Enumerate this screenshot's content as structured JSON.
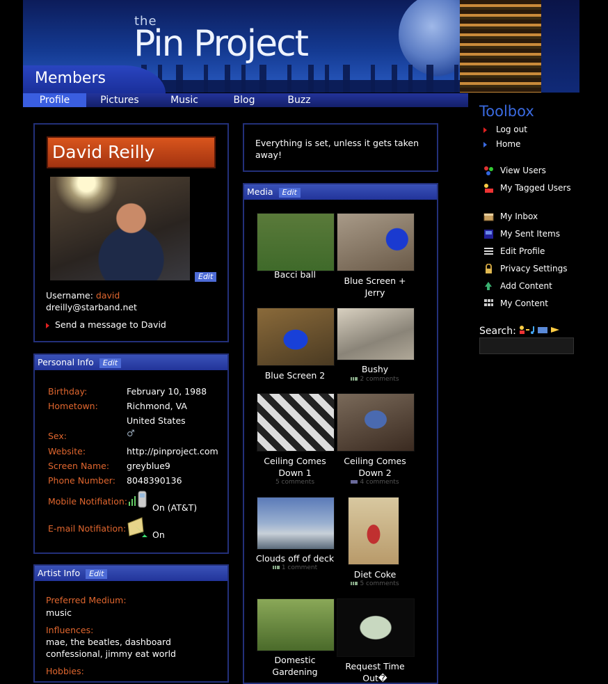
{
  "header": {
    "logo_the": "the",
    "logo_main": "Pin Project",
    "section_title": "Members"
  },
  "nav": [
    {
      "label": "Profile",
      "active": true
    },
    {
      "label": "Pictures",
      "active": false
    },
    {
      "label": "Music",
      "active": false
    },
    {
      "label": "Blog",
      "active": false
    },
    {
      "label": "Buzz",
      "active": false
    }
  ],
  "profile": {
    "name": "David Reilly",
    "edit_label": "Edit",
    "username_label": "Username:",
    "username": "david",
    "email": "dreilly@starband.net",
    "send_message": "Send a message to David"
  },
  "status": {
    "text": "Everything is set, unless it gets taken away!"
  },
  "personal_info": {
    "title": "Personal Info",
    "edit_label": "Edit",
    "fields": [
      {
        "label": "Birthday:",
        "value": "February 10, 1988"
      },
      {
        "label": "Hometown:",
        "value": "Richmond, VA"
      },
      {
        "label": "",
        "value": "United States"
      },
      {
        "label": "Sex:",
        "value": "♂"
      },
      {
        "label": "Website:",
        "value": "http://pinproject.com"
      },
      {
        "label": "Screen Name:",
        "value": "greyblue9"
      },
      {
        "label": "Phone Number:",
        "value": "8048390136"
      }
    ],
    "mobile_label": "Mobile Notifiation:",
    "mobile_value": "On (AT&T)",
    "email_label": "E-mail Notifiation:",
    "email_value": "On"
  },
  "artist_info": {
    "title": "Artist Info",
    "edit_label": "Edit",
    "medium_label": "Preferred Medium:",
    "medium_value": "music",
    "influences_label": "Influences:",
    "influences_value": "mae, the beatles, dashboard confessional, jimmy eat world",
    "hobbies_label": "Hobbies:"
  },
  "media": {
    "title": "Media",
    "edit_label": "Edit",
    "items": [
      {
        "caption": "Bacci ball",
        "comments": ""
      },
      {
        "caption": "Blue Screen + Jerry",
        "comments": ""
      },
      {
        "caption": "Blue Screen 2",
        "comments": ""
      },
      {
        "caption": "Bushy",
        "comments": "2 comments"
      },
      {
        "caption": "Ceiling Comes Down 1",
        "comments": "5 comments"
      },
      {
        "caption": "Ceiling Comes Down 2",
        "comments": "4 comments"
      },
      {
        "caption": "Clouds off of deck",
        "comments": "1 comment"
      },
      {
        "caption": "Diet Coke",
        "comments": "5 comments"
      },
      {
        "caption": "Domestic Gardening",
        "comments": ""
      },
      {
        "caption": "Request Time Out�",
        "comments": ""
      }
    ]
  },
  "toolbox": {
    "title": "Toolbox",
    "items": [
      {
        "label": "Log out",
        "icon": "red-arrow-icon"
      },
      {
        "label": "Home",
        "icon": "blue-arrow-icon"
      },
      {
        "label": "View Users",
        "icon": "users-icon"
      },
      {
        "label": "My Tagged Users",
        "icon": "tagged-users-icon"
      },
      {
        "label": "My Inbox",
        "icon": "inbox-icon"
      },
      {
        "label": "My Sent Items",
        "icon": "sent-items-icon"
      },
      {
        "label": "Edit Profile",
        "icon": "edit-profile-icon"
      },
      {
        "label": "Privacy Settings",
        "icon": "lock-icon"
      },
      {
        "label": "Add Content",
        "icon": "add-content-icon"
      },
      {
        "label": "My Content",
        "icon": "content-icon"
      }
    ],
    "search_label": "Search:",
    "search_value": ""
  },
  "colors": {
    "accent_orange": "#e0662e",
    "nav_blue": "#23349a",
    "toolbox_blue": "#3a6ae0",
    "name_box": "#c9471a"
  }
}
